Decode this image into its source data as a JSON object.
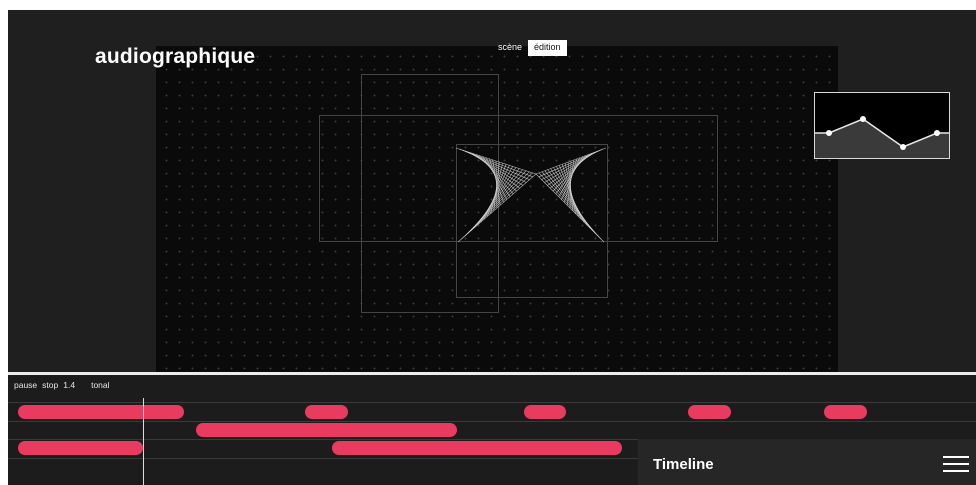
{
  "app": {
    "title": "audiographique"
  },
  "mode_toggle": {
    "items": [
      {
        "label": "scène",
        "active": false
      },
      {
        "label": "édition",
        "active": true
      }
    ]
  },
  "transport": {
    "pause": "pause",
    "stop": "stop",
    "tempo": "1.4",
    "mode": "tonal"
  },
  "timeline": {
    "label": "Timeline",
    "menu_icon": "hamburger-menu-icon",
    "track_count": 3,
    "clips_per_track": [
      5,
      1,
      2
    ]
  },
  "colors": {
    "background": "#1d1d1d",
    "canvas": "#0a0a0a",
    "clip": "#e83b5f",
    "text": "#ffffff",
    "active_toggle_bg": "#ffffff"
  }
}
